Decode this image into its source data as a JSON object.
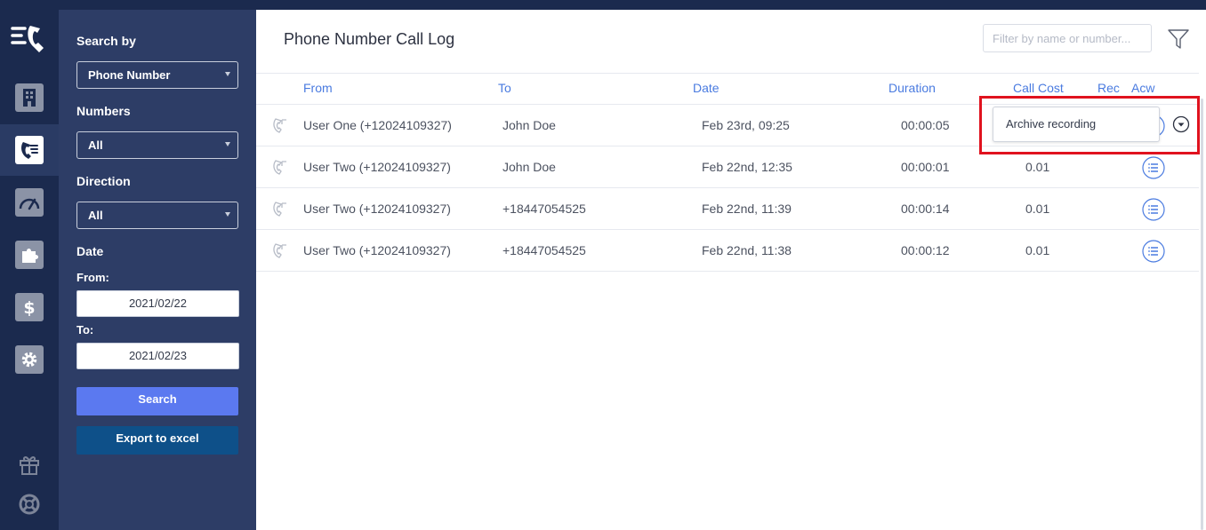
{
  "sidebar": {
    "nav": [
      "building-icon",
      "call-log-icon",
      "dashboard-gauge-icon",
      "puzzle-icon",
      "dollar-icon",
      "gear-icon"
    ],
    "active": "call-log-icon",
    "bottom": [
      "gift-icon",
      "lifebuoy-icon"
    ]
  },
  "filters": {
    "search_by_label": "Search by",
    "search_by_value": "Phone Number",
    "numbers_label": "Numbers",
    "numbers_value": "All",
    "direction_label": "Direction",
    "direction_value": "All",
    "date_label": "Date",
    "from_label": "From:",
    "from_value": "2021/02/22",
    "to_label": "To:",
    "to_value": "2021/02/23",
    "search_button": "Search",
    "export_button": "Export to excel"
  },
  "main": {
    "title": "Phone Number Call Log",
    "filter_placeholder": "Filter by name or number...",
    "columns": {
      "from": "From",
      "to": "To",
      "date": "Date",
      "duration": "Duration",
      "call_cost": "Call Cost",
      "rec": "Rec",
      "acw": "Acw"
    },
    "rows": [
      {
        "from": "User One (+12024109327)",
        "to": "John Doe",
        "date": "Feb 23rd, 09:25",
        "duration": "00:00:05",
        "cost": ""
      },
      {
        "from": "User Two (+12024109327)",
        "to": "John Doe",
        "date": "Feb 22nd, 12:35",
        "duration": "00:00:01",
        "cost": "0.01"
      },
      {
        "from": "User Two (+12024109327)",
        "to": "+18447054525",
        "date": "Feb 22nd, 11:39",
        "duration": "00:00:14",
        "cost": "0.01"
      },
      {
        "from": "User Two (+12024109327)",
        "to": "+18447054525",
        "date": "Feb 22nd, 11:38",
        "duration": "00:00:12",
        "cost": "0.01"
      }
    ],
    "dropdown_item": "Archive recording"
  },
  "colors": {
    "rail": "#1b2a4e",
    "panel": "#2d3d66",
    "accent": "#4a7be0",
    "search_button": "#5b79f0",
    "export_button": "#0e5089",
    "highlight": "#e0121e"
  }
}
